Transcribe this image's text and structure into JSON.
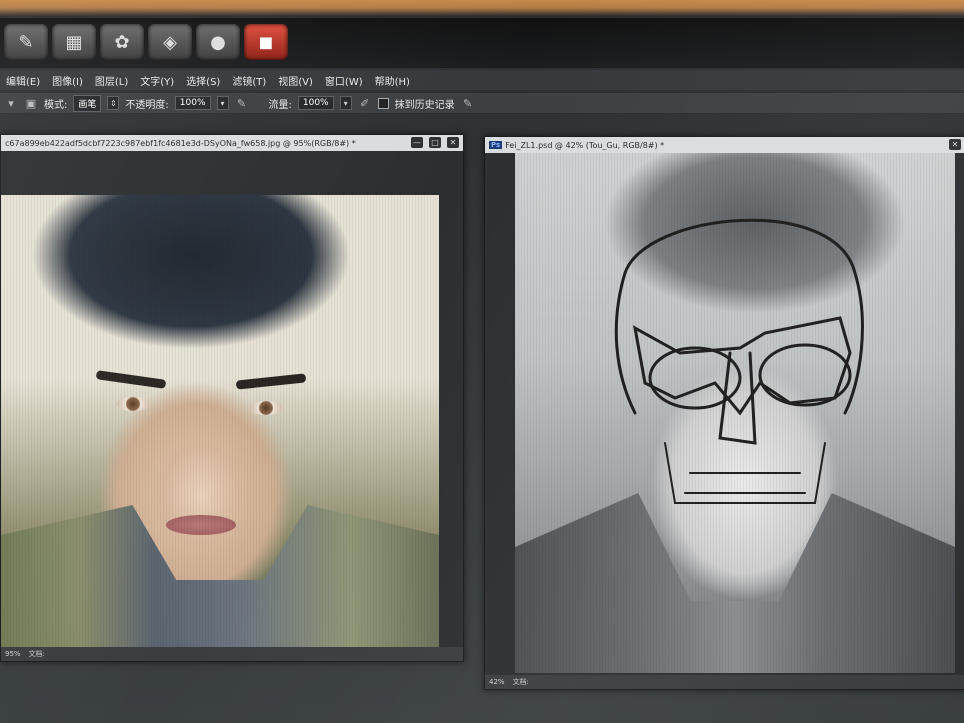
{
  "menubar": {
    "items": [
      "编辑(E)",
      "图像(I)",
      "图层(L)",
      "文字(Y)",
      "选择(S)",
      "滤镜(T)",
      "视图(V)",
      "窗口(W)",
      "帮助(H)"
    ]
  },
  "optbar": {
    "mode_label": "模式:",
    "mode_value": "画笔",
    "opacity_label": "不透明度:",
    "opacity_value": "100%",
    "flow_label": "流量:",
    "flow_value": "100%",
    "history_label": "抹到历史记录"
  },
  "left_doc": {
    "title": "c67a899eb422adf5dcbf7223c987ebf1fc4681e3d-DSyONa_fw658.jpg @ 95%(RGB/8#) *",
    "zoom": "95%",
    "status": "文档:"
  },
  "right_doc": {
    "title": "Fei_ZL1.psd @ 42% (Tou_Gu, RGB/8#) *",
    "badge": "Ps",
    "zoom": "42%",
    "status": "文档:"
  },
  "window_buttons": {
    "minimize": "—",
    "maximize": "□",
    "close": "✕"
  },
  "icons": [
    "photoshop-app-icon",
    "brush-icon",
    "airbrush-icon",
    "history-brush-icon"
  ]
}
